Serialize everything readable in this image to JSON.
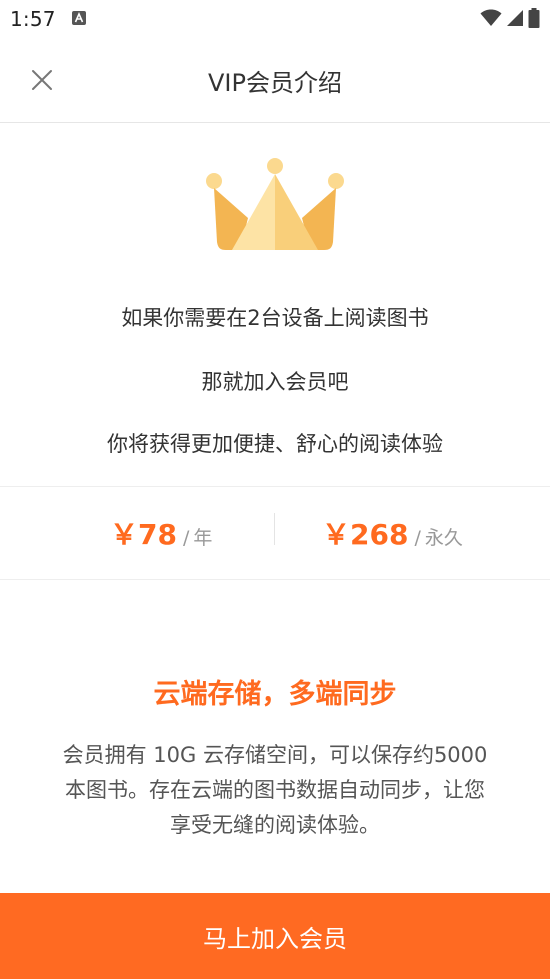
{
  "status_bar": {
    "time": "1:57"
  },
  "app_bar": {
    "title": "VIP会员介绍",
    "close_icon": "close-icon"
  },
  "intro": {
    "line1": "如果你需要在2台设备上阅读图书",
    "line2": "那就加入会员吧",
    "line3": "你将获得更加便捷、舒心的阅读体验"
  },
  "pricing": {
    "year": {
      "amount": "￥78",
      "separator": "/",
      "unit": "年"
    },
    "lifetime": {
      "amount": "￥268",
      "separator": "/",
      "unit": "永久"
    }
  },
  "feature": {
    "title": "云端存储，多端同步",
    "description": "会员拥有 10G 云存储空间，可以保存约5000本图书。存在云端的图书数据自动同步，让您享受无缝的阅读体验。"
  },
  "cta": {
    "label": "马上加入会员"
  },
  "colors": {
    "accent": "#ff6a1f",
    "cta_background": "#ff6a22",
    "crown_light": "#fde3a5",
    "crown_mid": "#f9cf7a",
    "crown_dark": "#f3b552"
  }
}
